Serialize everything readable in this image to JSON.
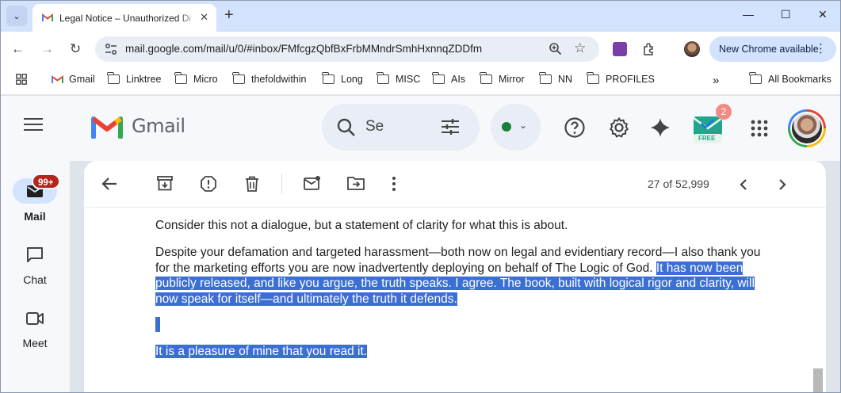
{
  "browser": {
    "tab_title": "Legal Notice – Unauthorized Di",
    "url": "mail.google.com/mail/u/0/#inbox/FMfcgzQbfBxFrbMMndrSmhHxnnqZDDfm",
    "update_label": "New Chrome available",
    "bookmarks": [
      {
        "label": "Gmail",
        "icon": "gmail-icon"
      },
      {
        "label": "Linktree",
        "icon": "folder-icon"
      },
      {
        "label": "Micro",
        "icon": "folder-icon"
      },
      {
        "label": "thefoldwithin",
        "icon": "folder-icon"
      },
      {
        "label": "Long",
        "icon": "folder-icon"
      },
      {
        "label": "MISC",
        "icon": "folder-icon"
      },
      {
        "label": "AIs",
        "icon": "folder-icon"
      },
      {
        "label": "Mirror",
        "icon": "folder-icon"
      },
      {
        "label": "NN",
        "icon": "folder-icon"
      },
      {
        "label": "PROFILES",
        "icon": "folder-icon"
      }
    ],
    "all_bookmarks_label": "All Bookmarks"
  },
  "gmail": {
    "brand": "Gmail",
    "search_text": "Se",
    "status_color": "#188038",
    "notification_count": "2",
    "free_label": "FREE"
  },
  "rail": {
    "mail_label": "Mail",
    "mail_badge": "99+",
    "chat_label": "Chat",
    "meet_label": "Meet"
  },
  "message": {
    "counter": "27 of 52,999",
    "paragraph1": "Consider this not a dialogue, but a statement of clarity for what this is about.",
    "p2_line1": "Despite your defamation and targeted harassment—both now on legal and evidentiary record—I also thank you",
    "p2_line2_plain": "for the marketing efforts you are now inadvertently deploying on behalf of The Logic of God.",
    "p2_line2_selected": "It has now been",
    "p2_line3": "publicly released, and like you argue, the truth speaks. I agree. The book, built with logical rigor and clarity, will",
    "p2_line4": "now speak for itself—and ultimately the truth it defends.",
    "closing": "It is a pleasure of mine that you read it."
  },
  "colors": {
    "selection": "#3b6fd4",
    "accent_blue": "#d3e3fd",
    "badge_red": "#b3261e"
  }
}
